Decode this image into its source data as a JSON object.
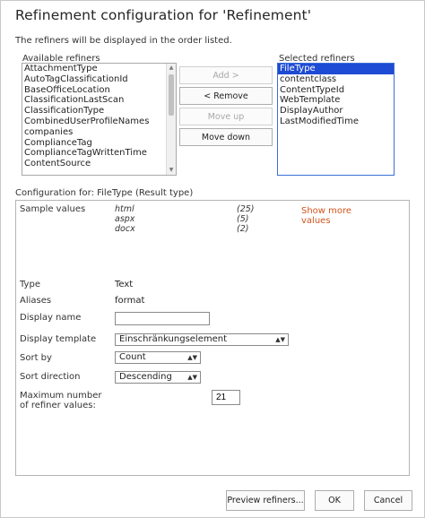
{
  "dialog": {
    "title": "Refinement configuration for 'Refinement'",
    "info": "The refiners will be displayed in the order listed."
  },
  "available": {
    "label": "Available refiners",
    "items": [
      "AttachmentType",
      "AutoTagClassificationId",
      "BaseOfficeLocation",
      "ClassificationLastScan",
      "ClassificationType",
      "CombinedUserProfileNames",
      "companies",
      "ComplianceTag",
      "ComplianceTagWrittenTime",
      "ContentSource"
    ]
  },
  "selected": {
    "label": "Selected refiners",
    "items": [
      "FileType",
      "contentclass",
      "ContentTypeId",
      "WebTemplate",
      "DisplayAuthor",
      "LastModifiedTime"
    ],
    "selected_index": 0
  },
  "buttons": {
    "add": "Add >",
    "remove": "< Remove",
    "move_up": "Move up",
    "move_down": "Move down"
  },
  "config": {
    "header": "Configuration for: FileType (Result type)",
    "sample_values_label": "Sample values",
    "samples": [
      {
        "value": "html",
        "count": "(25)"
      },
      {
        "value": "aspx",
        "count": "(5)"
      },
      {
        "value": "docx",
        "count": "(2)"
      }
    ],
    "show_more": "Show more values",
    "type_label": "Type",
    "type_value": "Text",
    "aliases_label": "Aliases",
    "aliases_value": "format",
    "display_name_label": "Display name",
    "display_name_value": "",
    "display_template_label": "Display template",
    "display_template_value": "Einschränkungselement",
    "sort_by_label": "Sort by",
    "sort_by_value": "Count",
    "sort_direction_label": "Sort direction",
    "sort_direction_value": "Descending",
    "max_values_label": "Maximum number of refiner values:",
    "max_values_value": "21"
  },
  "footer": {
    "preview": "Preview refiners...",
    "ok": "OK",
    "cancel": "Cancel"
  }
}
